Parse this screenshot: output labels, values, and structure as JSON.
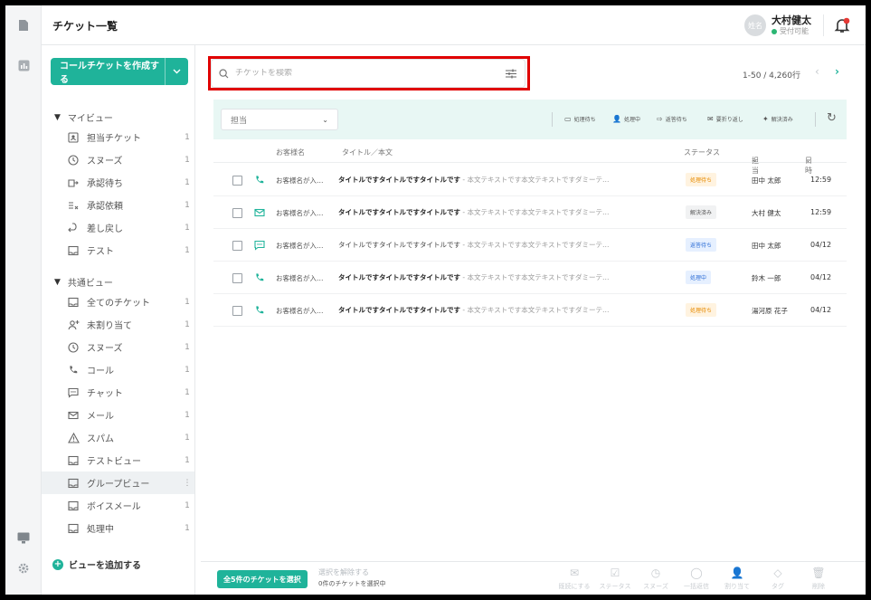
{
  "header": {
    "title": "チケット一覧",
    "avatar_text": "姓名",
    "user_name": "大村健太",
    "user_status": "受付可能"
  },
  "sidebar": {
    "create_button": "コールチケットを作成する",
    "my_view_label": "マイビュー",
    "my_view_items": [
      {
        "label": "担当チケット",
        "count": "1",
        "icon": "user-card-icon"
      },
      {
        "label": "スヌーズ",
        "count": "1",
        "icon": "clock-icon"
      },
      {
        "label": "承認待ち",
        "count": "1",
        "icon": "approval-wait-icon"
      },
      {
        "label": "承認依頼",
        "count": "1",
        "icon": "approval-request-icon"
      },
      {
        "label": "差し戻し",
        "count": "1",
        "icon": "return-icon"
      },
      {
        "label": "テスト",
        "count": "1",
        "icon": "inbox-icon"
      }
    ],
    "shared_view_label": "共通ビュー",
    "shared_view_items": [
      {
        "label": "全てのチケット",
        "count": "1",
        "icon": "inbox-icon"
      },
      {
        "label": "未割り当て",
        "count": "1",
        "icon": "add-user-icon"
      },
      {
        "label": "スヌーズ",
        "count": "1",
        "icon": "clock-icon"
      },
      {
        "label": "コール",
        "count": "1",
        "icon": "phone-icon"
      },
      {
        "label": "チャット",
        "count": "1",
        "icon": "chat-icon"
      },
      {
        "label": "メール",
        "count": "1",
        "icon": "mail-icon"
      },
      {
        "label": "スパム",
        "count": "1",
        "icon": "warning-icon"
      },
      {
        "label": "テストビュー",
        "count": "1",
        "icon": "inbox-icon"
      },
      {
        "label": "グループビュー",
        "count": "⋮",
        "icon": "inbox-icon"
      },
      {
        "label": "ボイスメール",
        "count": "1",
        "icon": "inbox-icon"
      },
      {
        "label": "処理中",
        "count": "1",
        "icon": "inbox-icon"
      }
    ],
    "add_view": "ビューを追加する"
  },
  "search": {
    "placeholder": "チケットを検索"
  },
  "pagination": {
    "range": "1-50 / 4,260行"
  },
  "toolbar": {
    "assignee_placeholder": "担当",
    "actions": [
      "処理待ち",
      "処理中",
      "返答待ち",
      "要折り返し",
      "解決済み"
    ]
  },
  "table": {
    "headers": {
      "customer": "お客様名",
      "title": "タイトル／本文",
      "status": "ステータス",
      "assignee": "担当",
      "date": "日時"
    },
    "rows": [
      {
        "channel": "phone-icon",
        "customer": "お客様名が入…",
        "title": "タイトルですタイトルですタイトルです",
        "body": " - 本文テキストです本文テキストですダミーテ…",
        "status": "処理待ち",
        "assignee": "田中 太郎",
        "time": "12:59",
        "bold": true
      },
      {
        "channel": "mail-icon",
        "customer": "お客様名が入…",
        "title": "タイトルですタイトルですタイトルです",
        "body": " - 本文テキストです本文テキストですダミーテ…",
        "status": "解決済み",
        "assignee": "大村 健太",
        "time": "12:59",
        "bold": true
      },
      {
        "channel": "chat-icon",
        "customer": "お客様名が入…",
        "title": "タイトルですタイトルですタイトルです",
        "body": " - 本文テキストです本文テキストですダミーテ…",
        "status": "返答待ち",
        "assignee": "田中 太郎",
        "time": "04/12",
        "bold": false
      },
      {
        "channel": "phone-icon",
        "customer": "お客様名が入…",
        "title": "タイトルですタイトルですタイトルです",
        "body": " - 本文テキストです本文テキストですダミーテ…",
        "status": "処理中",
        "assignee": "鈴木 一郎",
        "time": "04/12",
        "bold": true
      },
      {
        "channel": "phone-icon",
        "customer": "お客様名が入…",
        "title": "タイトルですタイトルですタイトルです",
        "body": " - 本文テキストです本文テキストですダミーテ…",
        "status": "処理待ち",
        "assignee": "湯河原 花子",
        "time": "04/12",
        "bold": true
      }
    ]
  },
  "status_styles": {
    "処理待ち": {
      "bg": "#fff3e0",
      "fg": "#e68a00"
    },
    "解決済み": {
      "bg": "#f1f2f3",
      "fg": "#555555"
    },
    "返答待ち": {
      "bg": "#e6f0ff",
      "fg": "#2f6fd6"
    },
    "処理中": {
      "bg": "#e6f0ff",
      "fg": "#2f6fd6"
    }
  },
  "bulk": {
    "select_all": "全5件のチケットを選択",
    "unselect": "選択を解除する",
    "selected_info": "0件のチケットを選択中",
    "actions": [
      "既読にする",
      "ステータス",
      "スヌーズ",
      "一括返信",
      "割り当て",
      "タグ",
      "削除"
    ]
  },
  "colors": {
    "accent": "#1fb39a",
    "highlight": "#e00000",
    "notification": "#e53935"
  }
}
